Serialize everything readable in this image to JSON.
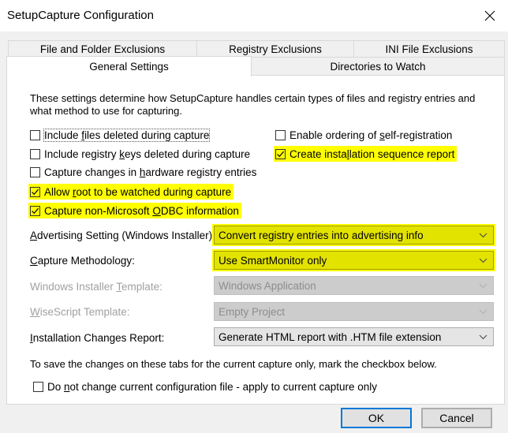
{
  "window": {
    "title": "SetupCapture Configuration",
    "close_icon": "close-x-icon"
  },
  "tabs": {
    "row1": [
      {
        "label": "File and Folder Exclusions"
      },
      {
        "label": "Registry Exclusions"
      },
      {
        "label": "INI File Exclusions"
      }
    ],
    "row2": [
      {
        "label": "General Settings",
        "active": true
      },
      {
        "label": "Directories to Watch",
        "active": false
      }
    ]
  },
  "general": {
    "intro": "These settings determine how SetupCapture handles certain types of files and registry entries and what method to use for capturing.",
    "checkboxes_left": [
      {
        "pre": "Include ",
        "key": "f",
        "post": "iles deleted during capture",
        "checked": false,
        "highlighted": false
      },
      {
        "pre": "Include registry ",
        "key": "k",
        "post": "eys deleted during capture",
        "checked": false,
        "highlighted": false
      },
      {
        "pre": "Capture changes in ",
        "key": "h",
        "post": "ardware registry entries",
        "checked": false,
        "highlighted": false
      },
      {
        "pre": "Allow ",
        "key": "r",
        "post": "oot to be watched during capture",
        "checked": true,
        "highlighted": true
      },
      {
        "pre": "Capture non-Microsoft ",
        "key": "O",
        "post": "DBC information",
        "checked": true,
        "highlighted": true
      }
    ],
    "checkboxes_right": [
      {
        "pre": "Enable ordering of ",
        "key": "s",
        "post": "elf-registration",
        "checked": false,
        "highlighted": false
      },
      {
        "pre": "Create insta",
        "key": "l",
        "post": "lation sequence report",
        "checked": true,
        "highlighted": true
      }
    ],
    "fields": [
      {
        "label_key": "A",
        "label_rest": "dvertising Setting (Windows Installer):",
        "label_pre": "",
        "value": "Convert registry entries into advertising info",
        "disabled": false,
        "highlighted": true
      },
      {
        "label_key": "C",
        "label_rest": "apture Methodology:",
        "label_pre": "",
        "value": "Use SmartMonitor only",
        "disabled": false,
        "highlighted": true
      },
      {
        "label_pre": "Windows Installer ",
        "label_key": "T",
        "label_rest": "emplate:",
        "value": "Windows Application",
        "disabled": true,
        "highlighted": false
      },
      {
        "label_pre": "",
        "label_key": "W",
        "label_rest": "iseScript Template:",
        "value": "Empty Project",
        "disabled": true,
        "highlighted": false
      },
      {
        "label_pre": "",
        "label_key": "I",
        "label_rest": "nstallation Changes Report:",
        "value": "Generate HTML report with .HTM file extension",
        "disabled": false,
        "highlighted": false
      }
    ],
    "note": "To save the changes on these tabs for the current capture only, mark the checkbox below.",
    "apply_current": {
      "pre": "Do ",
      "key": "n",
      "post": "ot change current configuration file - apply to current capture only",
      "checked": false
    }
  },
  "buttons": {
    "ok": "OK",
    "cancel": "Cancel"
  },
  "colors": {
    "highlight": "#ffff00",
    "default_button_border": "#0078d7"
  }
}
